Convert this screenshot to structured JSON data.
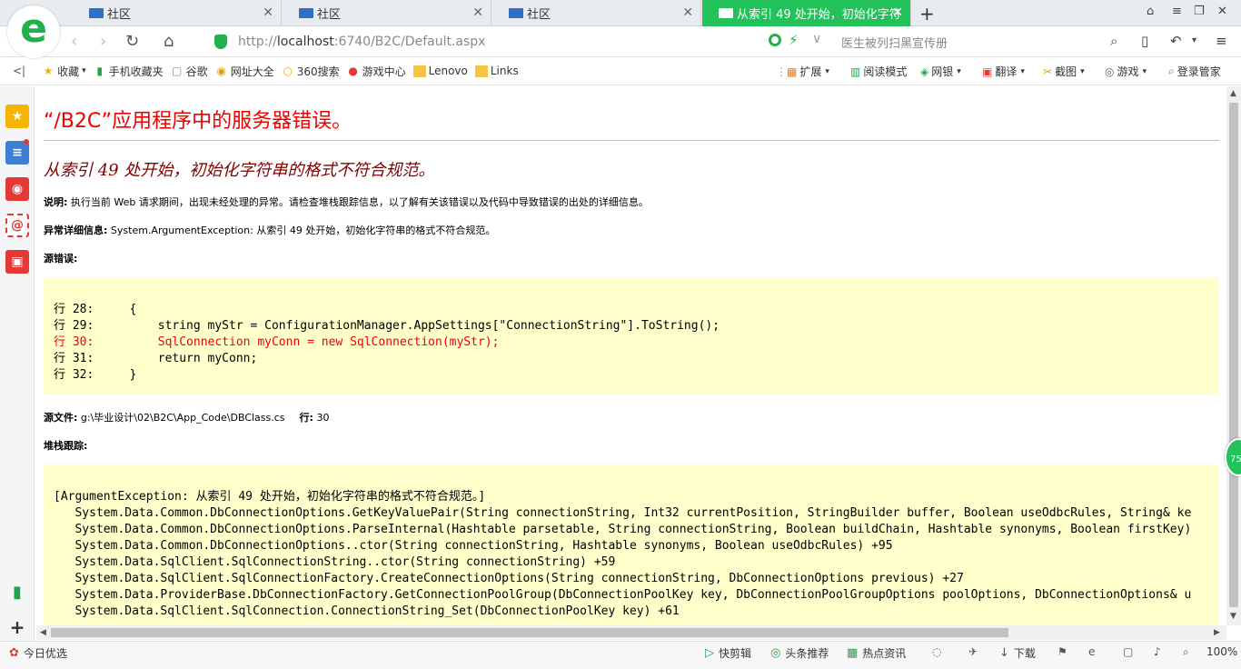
{
  "tabs": [
    {
      "label": "社区",
      "active": false
    },
    {
      "label": "社区",
      "active": false
    },
    {
      "label": "社区",
      "active": false
    },
    {
      "label": "从索引 49 处开始，初始化字符串",
      "active": true
    }
  ],
  "address": {
    "url_prefix": "http://",
    "url_host": "localhost",
    "url_rest": ":6740/B2C/Default.aspx",
    "search_placeholder": "医生被列扫黑宣传册"
  },
  "favorites": {
    "left": [
      "收藏",
      "手机收藏夹",
      "谷歌",
      "网址大全",
      "360搜索",
      "游戏中心",
      "Lenovo",
      "Links"
    ],
    "right": [
      "扩展",
      "阅读模式",
      "网银",
      "翻译",
      "截图",
      "游戏",
      "登录管家"
    ]
  },
  "page": {
    "title": "“/B2C”应用程序中的服务器错误。",
    "error_heading": "从索引 49 处开始，初始化字符串的格式不符合规范。",
    "desc_label": "说明:",
    "desc_text": " 执行当前 Web 请求期间，出现未经处理的异常。请检查堆栈跟踪信息，以了解有关该错误以及代码中导致错误的出处的详细信息。",
    "exception_label": "异常详细信息:",
    "exception_text": " System.ArgumentException: 从索引 49 处开始，初始化字符串的格式不符合规范。",
    "source_error_label": "源错误:",
    "source_lines": [
      {
        "text": "行 28:     {",
        "error": false
      },
      {
        "text": "行 29:         string myStr = ConfigurationManager.AppSettings[\"ConnectionString\"].ToString();",
        "error": false
      },
      {
        "text": "行 30:         SqlConnection myConn = new SqlConnection(myStr);",
        "error": true
      },
      {
        "text": "行 31:         return myConn;",
        "error": false
      },
      {
        "text": "行 32:     }",
        "error": false
      }
    ],
    "source_file_label": "源文件:",
    "source_file_value": " g:\\毕业设计\\02\\B2C\\App_Code\\DBClass.cs",
    "line_label": "行:",
    "line_value": " 30",
    "stack_label": "堆栈跟踪:",
    "stack_lines": [
      "[ArgumentException: 从索引 49 处开始，初始化字符串的格式不符合规范。]",
      "   System.Data.Common.DbConnectionOptions.GetKeyValuePair(String connectionString, Int32 currentPosition, StringBuilder buffer, Boolean useOdbcRules, String& ke",
      "   System.Data.Common.DbConnectionOptions.ParseInternal(Hashtable parsetable, String connectionString, Boolean buildChain, Hashtable synonyms, Boolean firstKey)",
      "   System.Data.Common.DbConnectionOptions..ctor(String connectionString, Hashtable synonyms, Boolean useOdbcRules) +95",
      "   System.Data.SqlClient.SqlConnectionString..ctor(String connectionString) +59",
      "   System.Data.SqlClient.SqlConnectionFactory.CreateConnectionOptions(String connectionString, DbConnectionOptions previous) +27",
      "   System.Data.ProviderBase.DbConnectionFactory.GetConnectionPoolGroup(DbConnectionPoolKey key, DbConnectionPoolGroupOptions poolOptions, DbConnectionOptions& u",
      "   System.Data.SqlClient.SqlConnection.ConnectionString_Set(DbConnectionPoolKey key) +61"
    ]
  },
  "status": {
    "left": "今日优选",
    "items": [
      "快剪辑",
      "头条推荐",
      "热点资讯",
      "下载"
    ],
    "zoom": "100%",
    "badge": "75"
  },
  "colors": {
    "accent": "#22c15a",
    "error_red": "#ee0000",
    "code_bg": "#ffffcc",
    "heading_maroon": "#800000"
  }
}
